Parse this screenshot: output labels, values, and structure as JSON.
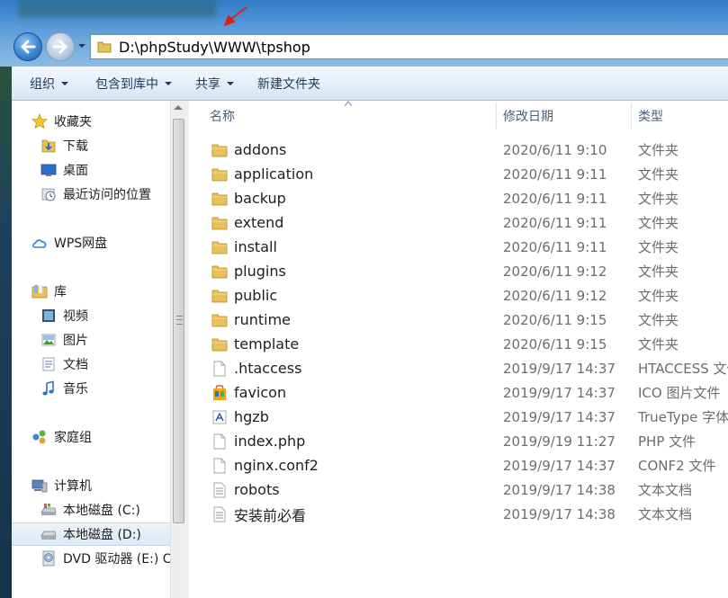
{
  "address": {
    "path": "D:\\phpStudy\\WWW\\tpshop"
  },
  "toolbar": {
    "organize": "组织",
    "include_in_library": "包含到库中",
    "share": "共享",
    "new_folder": "新建文件夹"
  },
  "nav": {
    "favorites": "收藏夹",
    "downloads": "下载",
    "desktop": "桌面",
    "recent": "最近访问的位置",
    "wps": "WPS网盘",
    "libraries": "库",
    "videos": "视频",
    "pictures": "图片",
    "documents": "文档",
    "music": "音乐",
    "homegroup": "家庭组",
    "computer": "计算机",
    "drive_c": "本地磁盘 (C:)",
    "drive_d": "本地磁盘 (D:)",
    "drive_e": "DVD 驱动器 (E:) C"
  },
  "columns": {
    "name": "名称",
    "date": "修改日期",
    "type": "类型"
  },
  "files": [
    {
      "name": "addons",
      "date": "2020/6/11 9:10",
      "type": "文件夹",
      "icon": "folder-icon"
    },
    {
      "name": "application",
      "date": "2020/6/11 9:11",
      "type": "文件夹",
      "icon": "folder-icon"
    },
    {
      "name": "backup",
      "date": "2020/6/11 9:11",
      "type": "文件夹",
      "icon": "folder-icon"
    },
    {
      "name": "extend",
      "date": "2020/6/11 9:11",
      "type": "文件夹",
      "icon": "folder-icon"
    },
    {
      "name": "install",
      "date": "2020/6/11 9:11",
      "type": "文件夹",
      "icon": "folder-icon"
    },
    {
      "name": "plugins",
      "date": "2020/6/11 9:12",
      "type": "文件夹",
      "icon": "folder-icon"
    },
    {
      "name": "public",
      "date": "2020/6/11 9:12",
      "type": "文件夹",
      "icon": "folder-icon"
    },
    {
      "name": "runtime",
      "date": "2020/6/11 9:15",
      "type": "文件夹",
      "icon": "folder-icon"
    },
    {
      "name": "template",
      "date": "2020/6/11 9:15",
      "type": "文件夹",
      "icon": "folder-icon"
    },
    {
      "name": ".htaccess",
      "date": "2019/9/17 14:37",
      "type": "HTACCESS 文件",
      "icon": "file-icon"
    },
    {
      "name": "favicon",
      "date": "2019/9/17 14:37",
      "type": "ICO 图片文件",
      "icon": "ico-file-icon"
    },
    {
      "name": "hgzb",
      "date": "2019/9/17 14:37",
      "type": "TrueType 字体文件",
      "icon": "font-file-icon"
    },
    {
      "name": "index.php",
      "date": "2019/9/19 11:27",
      "type": "PHP 文件",
      "icon": "file-icon"
    },
    {
      "name": "nginx.conf2",
      "date": "2019/9/17 14:37",
      "type": "CONF2 文件",
      "icon": "file-icon"
    },
    {
      "name": "robots",
      "date": "2019/9/17 14:38",
      "type": "文本文档",
      "icon": "text-file-icon"
    },
    {
      "name": "安装前必看",
      "date": "2019/9/17 14:38",
      "type": "文本文档",
      "icon": "text-file-icon"
    }
  ]
}
